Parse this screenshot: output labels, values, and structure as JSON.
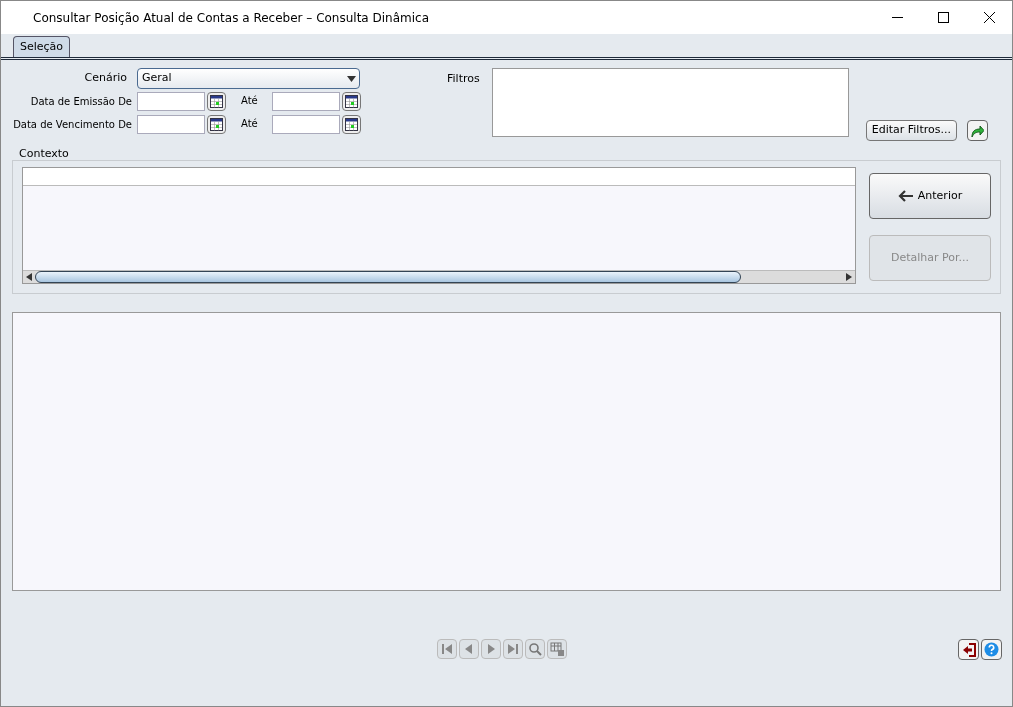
{
  "window": {
    "title": "Consultar Posição Atual de Contas a Receber – Consulta Dinâmica"
  },
  "tabs": [
    {
      "label": "Seleção",
      "selected": true
    }
  ],
  "form": {
    "scenario": {
      "label": "Cenário",
      "value": "Geral"
    },
    "date_rows": [
      {
        "label": "Data de Emissão De",
        "to_label": "Até"
      },
      {
        "label": "Data de Vencimento De",
        "to_label": "Até"
      }
    ],
    "filters": {
      "label": "Filtros"
    },
    "edit_filters_button": {
      "label": "Editar Filtros..."
    }
  },
  "context": {
    "title": "Contexto",
    "buttons": [
      {
        "label": "Anterior",
        "disabled": false,
        "kind": "back"
      },
      {
        "label": "Detalhar Por...",
        "disabled": true,
        "kind": "plain"
      }
    ]
  },
  "navigation": [
    {
      "kind": "first",
      "disabled": true
    },
    {
      "kind": "prev",
      "disabled": true
    },
    {
      "kind": "next",
      "disabled": true
    },
    {
      "kind": "last",
      "disabled": true
    },
    {
      "kind": "search",
      "disabled": true
    },
    {
      "kind": "grid",
      "disabled": true
    }
  ]
}
